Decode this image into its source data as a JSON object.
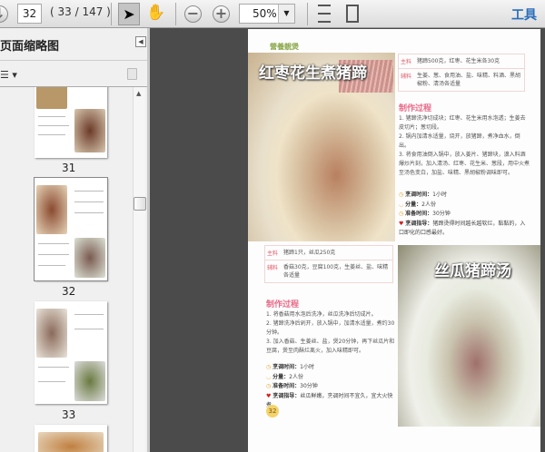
{
  "toolbar": {
    "page_input": "32",
    "page_count": "( 33 / 147 )",
    "zoom": "50%",
    "tools_label": "工具"
  },
  "sidebar": {
    "title": "页面缩略图",
    "thumbnails": [
      {
        "label": "31"
      },
      {
        "label": "32"
      },
      {
        "label": "33"
      }
    ]
  },
  "document": {
    "brand": "營養靚煲",
    "recipe1": {
      "title": "红枣花生煮猪蹄",
      "main_label": "主料",
      "main": "猪蹄500克，红枣、花生米各30克",
      "aux_label": "辅料",
      "aux": "生姜、葱、食用油、盐、味精、料酒、黑胡椒粉、清汤各适量",
      "process_label": "制作过程",
      "steps": [
        "1. 猪蹄洗净切成块；红枣、花生米用水泡透；生姜去皮切片；葱切段。",
        "2. 锅内加清水适量，烧开，放猪蹄，煮净血水，倒出。",
        "3. 将食用油倒入锅中，放入姜片、猪蹄块，濞入料酒爆炒片刻，加入清汤、红枣、花生米、葱段，用中火煮至汤色变白，加盐、味精、黑胡椒粉调味即可。"
      ],
      "info": [
        {
          "label": "烹调时间：",
          "value": "1小时"
        },
        {
          "label": "分量：",
          "value": "2人份"
        },
        {
          "label": "准备时间：",
          "value": "30分钟"
        },
        {
          "label": "烹调指导：",
          "value": "猪蹄烫得时间越长越软烂，黏黏的，入口即化的口感最好。"
        }
      ]
    },
    "recipe2": {
      "title": "丝瓜猪蹄汤",
      "main_label": "主料",
      "main": "猪蹄1只，丝瓜250克",
      "aux_label": "辅料",
      "aux": "香菇30克，豆腐100克，生姜丝、盐、味精各适量",
      "process_label": "制作过程",
      "steps": [
        "1. 将香菇用水泡后洗净，丝瓜洗净后切成片。",
        "2. 猪蹄洗净后剁开，放入锅中，加清水适量，煮约30分钟。",
        "3. 加入香菇、生姜丝、盐，煲20分钟，再下丝瓜片和豆腐，煲至肉酥烂离火，加入味精即可。"
      ],
      "info": [
        {
          "label": "烹调时间：",
          "value": "1小时"
        },
        {
          "label": "分量：",
          "value": "2人份"
        },
        {
          "label": "准备时间：",
          "value": "30分钟"
        },
        {
          "label": "烹调指导：",
          "value": "丝瓜鲜嫩，烹调时间不宜久，宜大火快煮。"
        }
      ]
    },
    "page_number": "32"
  }
}
